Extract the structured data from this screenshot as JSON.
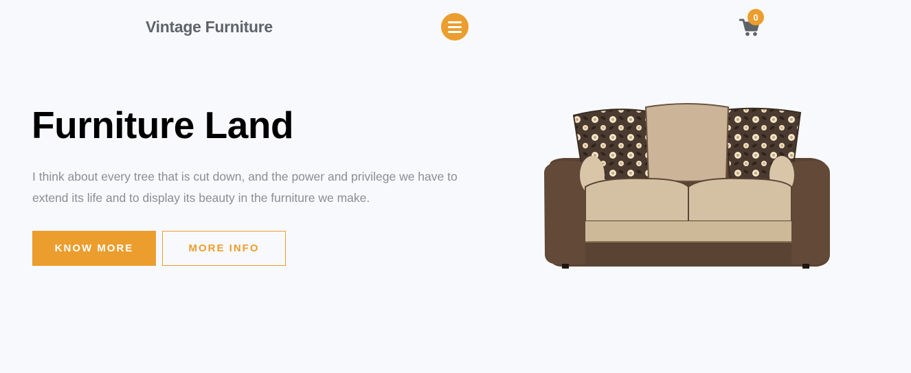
{
  "header": {
    "brand": "Vintage Furniture",
    "menu_icon": "hamburger-menu-icon",
    "cart_icon": "shopping-cart-icon",
    "cart_count": "0"
  },
  "hero": {
    "title": "Furniture Land",
    "description": "I think about every tree that is cut down, and the power and privilege we have to extend its life and to display its beauty in the furniture we make.",
    "primary_button": "KNOW MORE",
    "secondary_button": "MORE INFO",
    "image": "sofa-image"
  },
  "colors": {
    "accent": "#eb9d2e",
    "background": "#f8f9fc",
    "text_dark": "#000000",
    "text_muted": "#8a8d93",
    "brand_text": "#5f6368"
  }
}
